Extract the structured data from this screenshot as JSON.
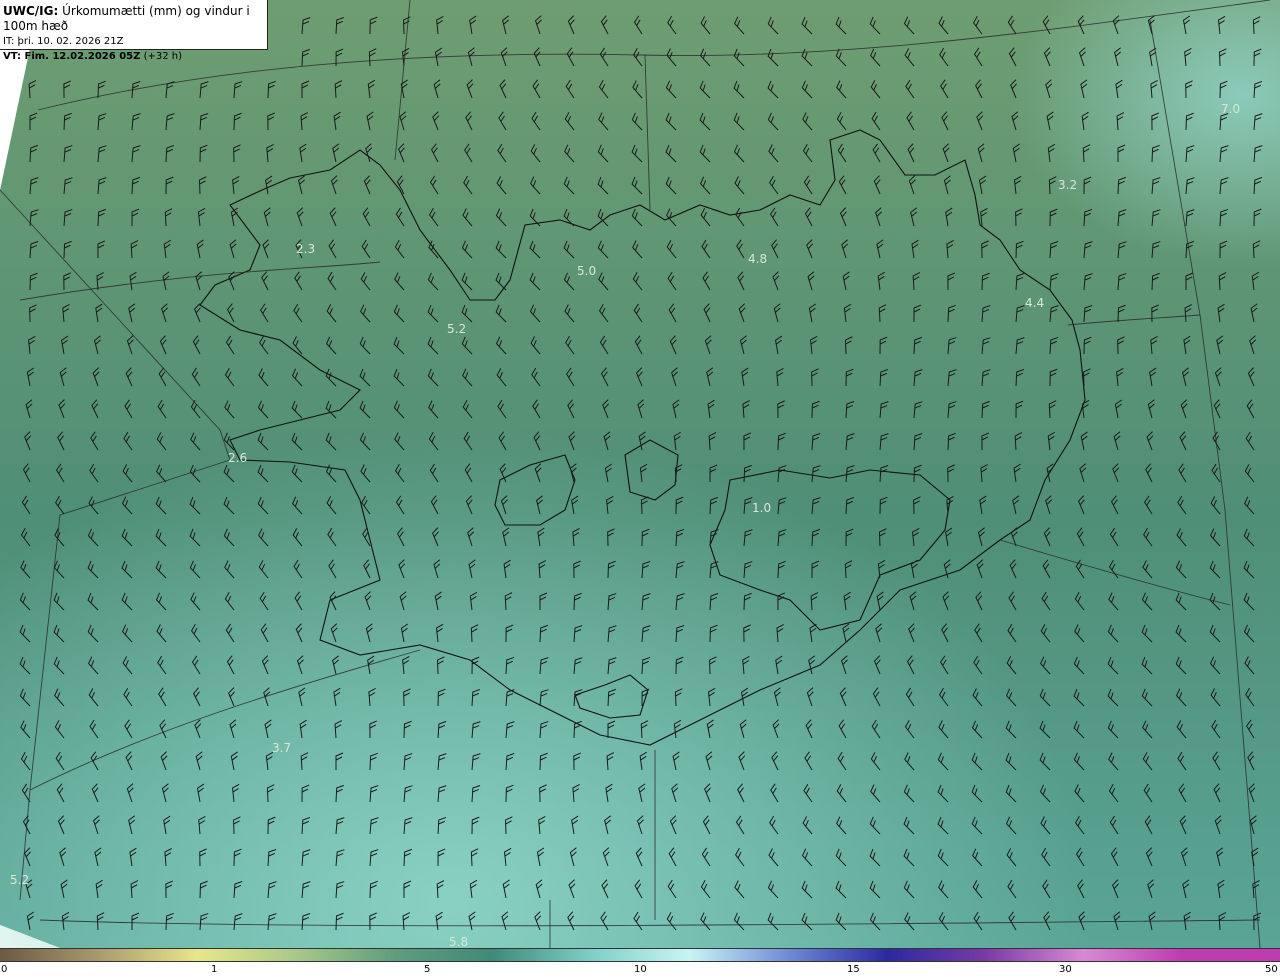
{
  "title": {
    "model": "UWC/IG:",
    "field": "Úrkomumætti (mm) og vindur i 100m hæð",
    "init_label": "IT:",
    "init_time": "þri. 10. 02. 2026 21Z",
    "valid_label": "VT: Fim. 12.02.2026 05Z",
    "lead_time": "(+32 h)"
  },
  "value_labels": [
    "7.0",
    "3.2",
    "2.3",
    "5.0",
    "4.8",
    "4.4",
    "5.2",
    "2.6",
    "1.0",
    "3.7",
    "5.2",
    "5.8"
  ],
  "colorbar": {
    "ticks": [
      "0",
      "1",
      "5",
      "10",
      "15",
      "30",
      "50"
    ],
    "colors": [
      "#6b5a44",
      "#a99a6e",
      "#e8e68a",
      "#a8c98a",
      "#5f9d7c",
      "#3f8a7a",
      "#7fcfc6",
      "#c9f4f4",
      "#6f8ad6",
      "#2a2aa0",
      "#7a3aa6",
      "#d78ad4",
      "#c03ab0"
    ]
  },
  "colors": {
    "sea": "#4e8f78",
    "land": "#c6cf86"
  }
}
